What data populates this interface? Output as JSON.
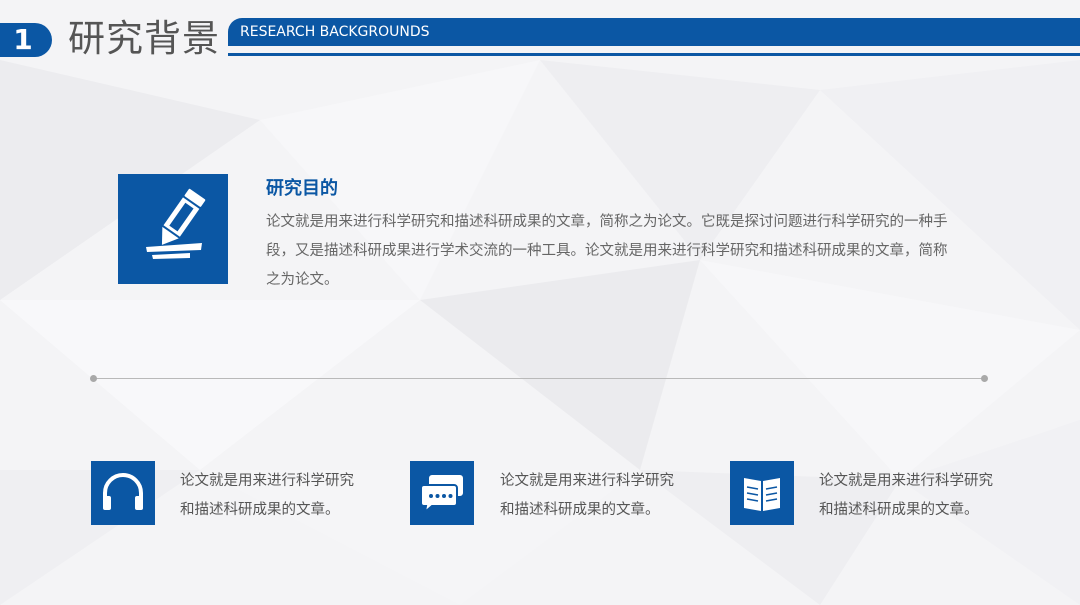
{
  "header": {
    "section_number": "1",
    "section_title": "研究背景",
    "band_label": "RESEARCH BACKGROUNDS",
    "accent_color": "#0b57a4"
  },
  "feature": {
    "icon": "pencil-writing-icon",
    "title": "研究目的",
    "body": "论文就是用来进行科学研究和描述科研成果的文章，简称之为论文。它既是探讨问题进行科学研究的一种手段，又是描述科研成果进行学术交流的一种工具。论文就是用来进行科学研究和描述科研成果的文章，简称之为论文。"
  },
  "items": [
    {
      "icon": "headphones-icon",
      "line1": "论文就是用来进行科学研究",
      "line2": "和描述科研成果的文章。"
    },
    {
      "icon": "chat-bubbles-icon",
      "line1": "论文就是用来进行科学研究",
      "line2": "和描述科研成果的文章。"
    },
    {
      "icon": "open-book-icon",
      "line1": "论文就是用来进行科学研究",
      "line2": "和描述科研成果的文章。"
    }
  ]
}
